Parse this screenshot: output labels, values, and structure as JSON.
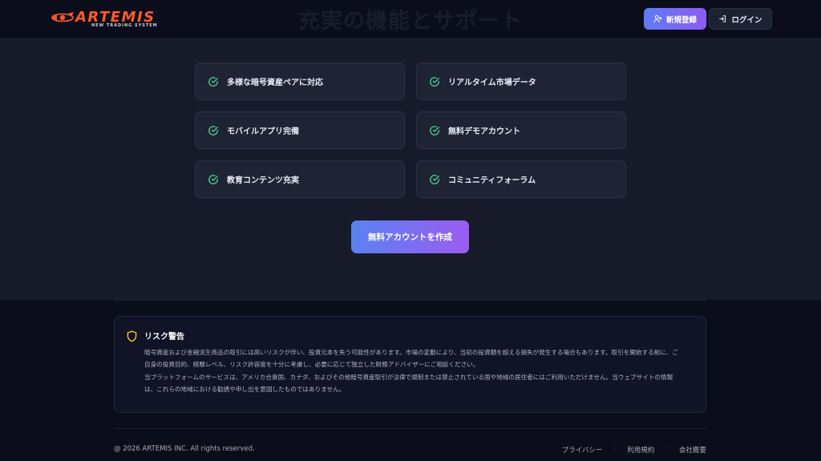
{
  "header": {
    "ghost_title": "充実の機能とサポート",
    "logo_text": "ARTEMIS",
    "logo_subtext": "NEW TRADING SYSTEM",
    "signup_label": "新規登録",
    "login_label": "ログイン"
  },
  "features": [
    {
      "label": "多様な暗号資産ペアに対応",
      "icon": "check-circle-icon"
    },
    {
      "label": "リアルタイム市場データ",
      "icon": "check-circle-icon"
    },
    {
      "label": "モバイルアプリ完備",
      "icon": "check-circle-icon"
    },
    {
      "label": "無料デモアカウント",
      "icon": "check-circle-icon"
    },
    {
      "label": "教育コンテンツ充実",
      "icon": "check-circle-icon"
    },
    {
      "label": "コミュニティフォーラム",
      "icon": "check-circle-icon"
    }
  ],
  "cta_label": "無料アカウントを作成",
  "risk": {
    "title": "リスク警告",
    "icon": "shield-icon",
    "paragraph1_line1": "暗号資産および金融派生商品の取引には高いリスクが伴い、投資元本を失う可能性があります。市場の変動により、当初の投資額を超える損失が発生する場合もあります。取引を開始する前に、ご",
    "paragraph1_line2": "自身の投資目的、経験レベル、リスク許容度を十分に考慮し、必要に応じて独立した財務アドバイザーにご相談ください。",
    "paragraph2_line1": "当プラットフォームのサービスは、アメリカ合衆国、カナダ、およびその他暗号資産取引が法律で規制または禁止されている国や地域の居住者にはご利用いただけません。当ウェブサイトの情報",
    "paragraph2_line2": "は、これらの地域における勧誘や申し出を意図したものではありません。"
  },
  "footer": {
    "copyright": "@ 2026 ARTEMIS INC. All rights reserved.",
    "links": [
      "プライバシー",
      "利用規約",
      "会社概要"
    ],
    "separator": "·"
  },
  "colors": {
    "accent_start": "#5a82f0",
    "accent_end": "#9a5cef",
    "check": "#4cc38a",
    "shield": "#f5c542",
    "logo": "#ff5a2a"
  }
}
